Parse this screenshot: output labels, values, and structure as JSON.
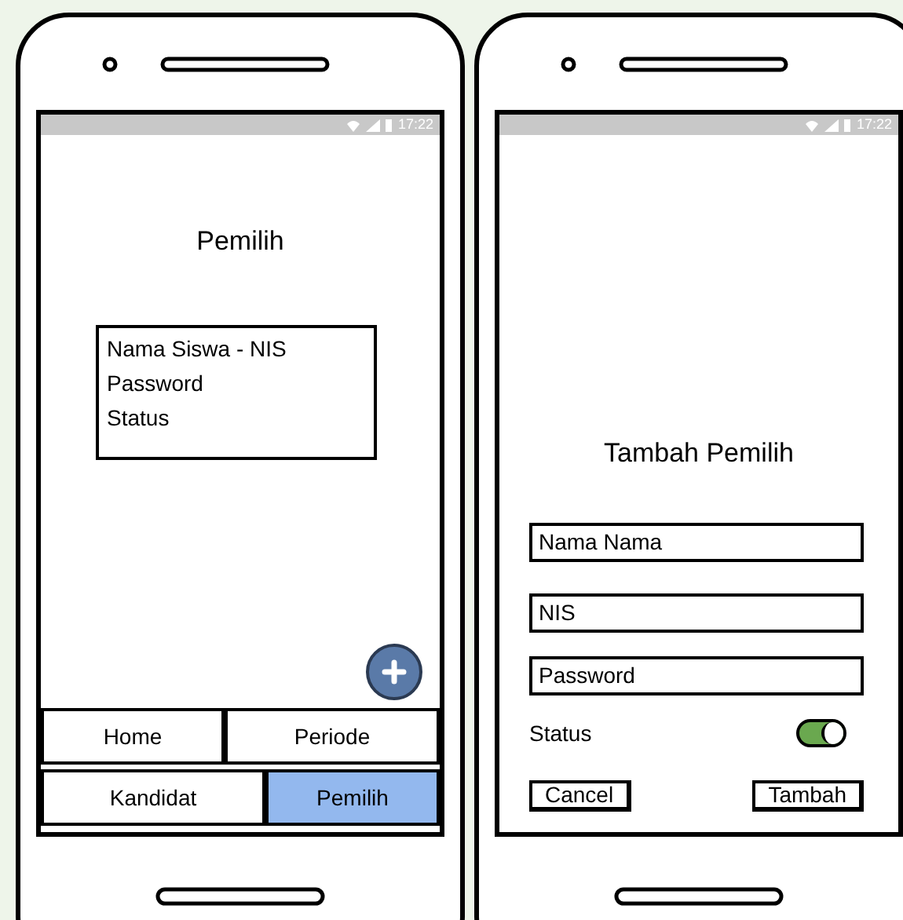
{
  "screens": [
    {
      "kind": "list",
      "status_time": "17:22",
      "title": "Pemilih",
      "list_items": [
        "Nama Siswa - NIS",
        "Password",
        "Status"
      ],
      "nav": [
        {
          "label": "Home",
          "selected": false
        },
        {
          "label": "Periode",
          "selected": false
        },
        {
          "label": "Kandidat",
          "selected": false
        },
        {
          "label": "Pemilih",
          "selected": true
        }
      ]
    },
    {
      "kind": "form",
      "status_time": "17:22",
      "title": "Tambah Pemilih",
      "fields": [
        {
          "value": "Nama Nama"
        },
        {
          "value": "NIS"
        },
        {
          "value": "Password"
        }
      ],
      "toggle": {
        "label": "Status",
        "on": true
      },
      "buttons": [
        {
          "label": "Cancel"
        },
        {
          "label": "Tambah"
        }
      ]
    }
  ]
}
